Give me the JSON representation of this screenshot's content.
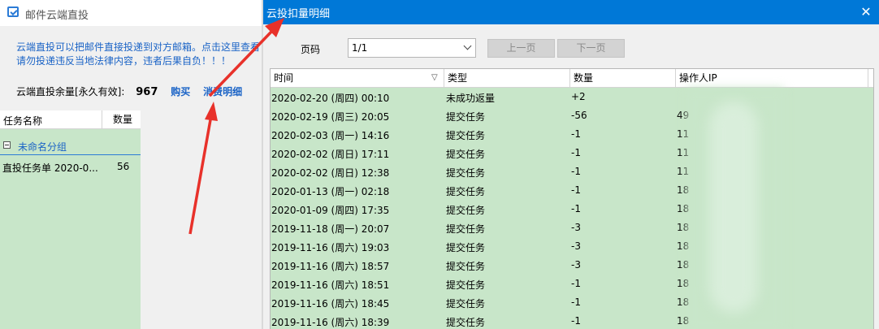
{
  "left_window": {
    "title": "邮件云端直投",
    "notice_line1": "云端直投可以把邮件直接投递到对方邮箱。点击这里查看",
    "notice_line2": "请勿投递违反当地法律内容，违者后果自负！！！",
    "quota_label": "云端直投余量[永久有效]:",
    "quota_value": "967",
    "buy_link": "购买",
    "details_link": "消费明细",
    "task_table": {
      "col_name": "任务名称",
      "col_count": "数量",
      "group_label": "未命名分组",
      "task_name": "直投任务单 2020-0...",
      "task_count": "56"
    }
  },
  "right_window": {
    "title": "云投扣量明细",
    "page_label": "页码",
    "page_select": "1/1",
    "prev_button": "上一页",
    "next_button": "下一页",
    "columns": [
      "时间",
      "类型",
      "数量",
      "操作人IP"
    ],
    "rows": [
      {
        "time": "2020-02-20 (周四) 00:10",
        "type": "未成功返量",
        "qty": "+2",
        "ip": ""
      },
      {
        "time": "2020-02-19 (周三) 20:05",
        "type": "提交任务",
        "qty": "-56",
        "ip": "49"
      },
      {
        "time": "2020-02-03 (周一) 14:16",
        "type": "提交任务",
        "qty": "-1",
        "ip": "11"
      },
      {
        "time": "2020-02-02 (周日) 17:11",
        "type": "提交任务",
        "qty": "-1",
        "ip": "11"
      },
      {
        "time": "2020-02-02 (周日) 12:38",
        "type": "提交任务",
        "qty": "-1",
        "ip": "11"
      },
      {
        "time": "2020-01-13 (周一) 02:18",
        "type": "提交任务",
        "qty": "-1",
        "ip": "18"
      },
      {
        "time": "2020-01-09 (周四) 17:35",
        "type": "提交任务",
        "qty": "-1",
        "ip": "18"
      },
      {
        "time": "2019-11-18 (周一) 20:07",
        "type": "提交任务",
        "qty": "-3",
        "ip": "18"
      },
      {
        "time": "2019-11-16 (周六) 19:03",
        "type": "提交任务",
        "qty": "-3",
        "ip": "18"
      },
      {
        "time": "2019-11-16 (周六) 18:57",
        "type": "提交任务",
        "qty": "-3",
        "ip": "18"
      },
      {
        "time": "2019-11-16 (周六) 18:51",
        "type": "提交任务",
        "qty": "-1",
        "ip": "18"
      },
      {
        "time": "2019-11-16 (周六) 18:45",
        "type": "提交任务",
        "qty": "-1",
        "ip": "18"
      },
      {
        "time": "2019-11-16 (周六) 18:39",
        "type": "提交任务",
        "qty": "-1",
        "ip": "18"
      }
    ]
  },
  "colors": {
    "accent": "#0078d7",
    "link": "#1a63c6",
    "row_green": "#c8e6c9",
    "annotation_red": "#e8312a"
  }
}
